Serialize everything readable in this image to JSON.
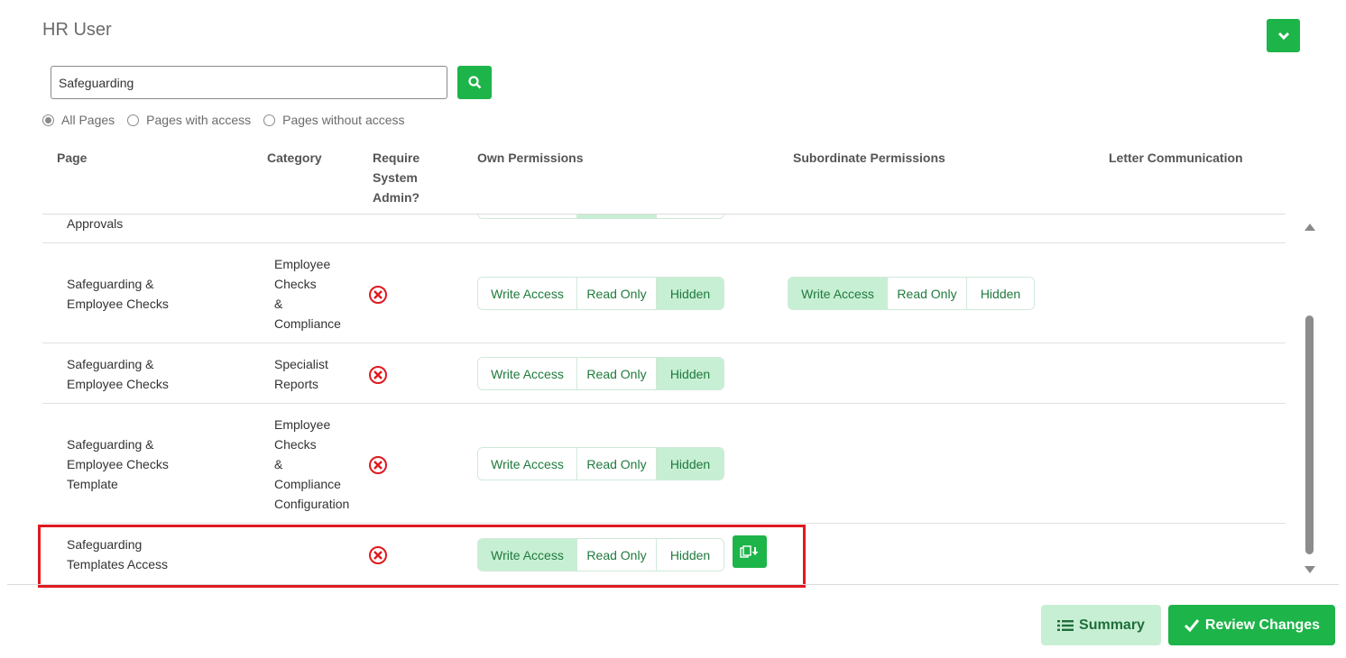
{
  "header": {
    "title": "HR User"
  },
  "search": {
    "value": "Safeguarding"
  },
  "filters": [
    {
      "label": "All Pages",
      "selected": true
    },
    {
      "label": "Pages with access",
      "selected": false
    },
    {
      "label": "Pages without access",
      "selected": false
    }
  ],
  "columns": {
    "page": "Page",
    "category": "Category",
    "require_line1": "Require",
    "require_line2": "System",
    "require_line3": "Admin?",
    "own": "Own Permissions",
    "subordinate": "Subordinate Permissions",
    "letter": "Letter Communication"
  },
  "options": {
    "write": "Write Access",
    "read": "Read Only",
    "hidden": "Hidden"
  },
  "rows": [
    {
      "page_lines": [
        "Approvals"
      ],
      "category_lines": [],
      "own": "Hidden"
    },
    {
      "page_lines": [
        "Safeguarding &",
        "Employee Checks"
      ],
      "category_lines": [
        "Employee",
        "Checks",
        "&",
        "Compliance"
      ],
      "own": "Hidden",
      "subordinate": "Write Access"
    },
    {
      "page_lines": [
        "Safeguarding &",
        "Employee Checks"
      ],
      "category_lines": [
        "Specialist",
        "Reports"
      ],
      "own": "Hidden"
    },
    {
      "page_lines": [
        "Safeguarding &",
        "Employee Checks",
        "Template"
      ],
      "category_lines": [
        "Employee",
        "Checks",
        "&",
        "Compliance",
        "Configuration"
      ],
      "own": "Hidden"
    },
    {
      "page_lines": [
        "Safeguarding",
        "Templates Access"
      ],
      "category_lines": [],
      "own": "Write Access"
    }
  ],
  "footer": {
    "summary_label": "Summary",
    "review_label": "Review Changes"
  },
  "colors": {
    "brand_green": "#1db449",
    "active_option": "#c7efd4",
    "highlight": "#e0191f",
    "error": "#e0191f"
  }
}
